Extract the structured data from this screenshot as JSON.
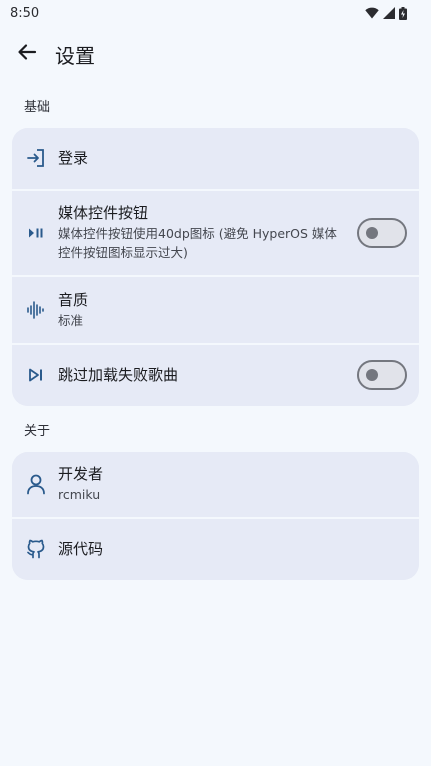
{
  "status_bar": {
    "time": "8:50",
    "icons": [
      "wifi-icon",
      "signal-icon",
      "battery-charging-icon"
    ]
  },
  "app_bar": {
    "back_icon": "arrow-back-icon",
    "title": "设置"
  },
  "sections": {
    "basic": {
      "header": "基础",
      "items": {
        "login": {
          "icon": "login-icon",
          "title": "登录"
        },
        "media_controls": {
          "icon": "play-pause-icon",
          "title": "媒体控件按钮",
          "subtitle": "媒体控件按钮使用40dp图标 (避免 HyperOS 媒体控件按钮图标显示过大)",
          "toggle_on": false
        },
        "quality": {
          "icon": "audio-wave-icon",
          "title": "音质",
          "subtitle": "标准"
        },
        "skip_failed": {
          "icon": "skip-next-icon",
          "title": "跳过加载失败歌曲",
          "toggle_on": false
        }
      }
    },
    "about": {
      "header": "关于",
      "items": {
        "developer": {
          "icon": "person-icon",
          "title": "开发者",
          "subtitle": "rcmiku"
        },
        "source_code": {
          "icon": "github-icon",
          "title": "源代码"
        }
      }
    }
  },
  "colors": {
    "background": "#f4f8fd",
    "card": "#e6eaf6",
    "icon_accent": "#2a5a8c",
    "switch_outline": "#74777f"
  }
}
